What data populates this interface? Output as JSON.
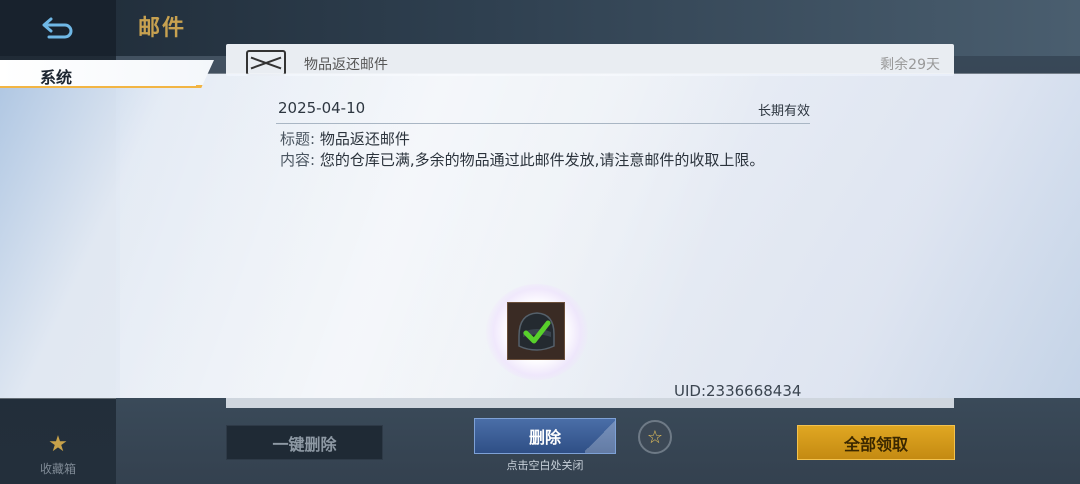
{
  "header": {
    "back_icon": "back-arrow-icon",
    "title": "邮件"
  },
  "mail_list_row": {
    "title": "物品返还邮件",
    "remaining": "剩余29天"
  },
  "category": {
    "label": "系统"
  },
  "mail": {
    "date": "2025-04-10",
    "validity": "长期有效",
    "subject_label": "标题:",
    "subject": "物品返还邮件",
    "content_label": "内容:",
    "content": "您的仓库已满,多余的物品通过此邮件发放,请注意邮件的收取上限。",
    "attachment_icon": "helmet-checked-icon",
    "uid": "UID:2336668434"
  },
  "sidebar": {
    "favorites_label": "收藏箱",
    "favorites_icon": "star-icon"
  },
  "footer": {
    "delete_all_label": "一键删除",
    "delete_label": "删除",
    "close_hint": "点击空白处关闭",
    "favorite_icon": "star-outline-icon",
    "claim_all_label": "全部领取"
  },
  "colors": {
    "accent_gold": "#e0a722",
    "title_gold": "#c7a150",
    "delete_blue": "#3f62a0",
    "back_blue": "#6fb8e6"
  }
}
